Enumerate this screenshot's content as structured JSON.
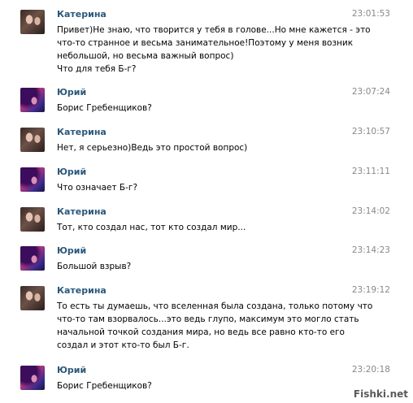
{
  "messages": [
    {
      "sender": "Катерина",
      "time": "23:01:53",
      "avatar": "katerina",
      "lines": [
        "Привет)Не знаю, что творится у тебя в голове...Но мне кажется - это",
        "что-то странное и весьма занимательное!Поэтому у меня возник",
        "небольшой, но весьма важный вопрос)",
        "Что для тебя Б-г?"
      ]
    },
    {
      "sender": "Юрий",
      "time": "23:07:24",
      "avatar": "yuriy",
      "lines": [
        "Борис Гребенщиков?"
      ]
    },
    {
      "sender": "Катерина",
      "time": "23:10:57",
      "avatar": "katerina",
      "lines": [
        "Нет, я серьезно)Ведь это простой вопрос)"
      ]
    },
    {
      "sender": "Юрий",
      "time": "23:11:11",
      "avatar": "yuriy",
      "lines": [
        "Что означает Б-г?"
      ]
    },
    {
      "sender": "Катерина",
      "time": "23:14:02",
      "avatar": "katerina",
      "lines": [
        "Тот, кто создал нас, тот кто создал мир..."
      ]
    },
    {
      "sender": "Юрий",
      "time": "23:14:23",
      "avatar": "yuriy",
      "lines": [
        "Большой взрыв?"
      ]
    },
    {
      "sender": "Катерина",
      "time": "23:19:12",
      "avatar": "katerina",
      "lines": [
        "То есть ты думаешь, что вселенная была создана, только потому что",
        "что-то там взорвалось...это ведь глупо, максимум это могло стать",
        "начальной точкой создания мира, но ведь все равно кто-то его",
        "создал и этот кто-то был Б-г."
      ]
    },
    {
      "sender": "Юрий",
      "time": "23:20:18",
      "avatar": "yuriy",
      "lines": [
        "Борис Гребенщиков?"
      ]
    }
  ],
  "watermark": "Fishki.net"
}
